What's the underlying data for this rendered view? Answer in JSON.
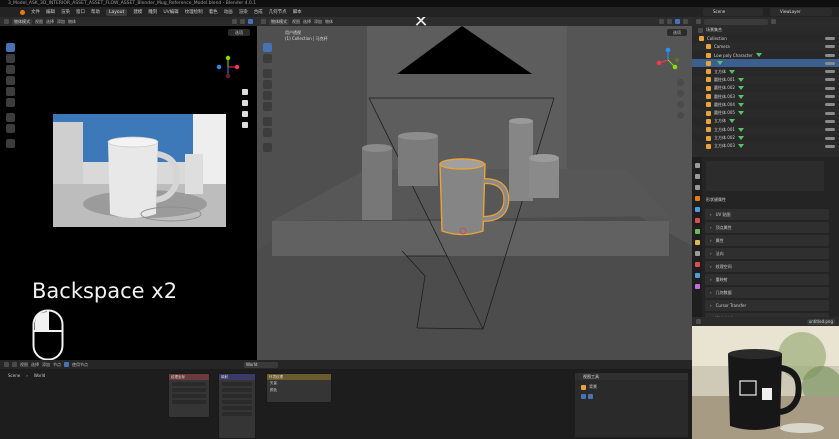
{
  "titlebar": {
    "text": "3_Model_ASK_3D_INTERIOR_ASSET_ASSET_FLOW_ASSET_Blender_Mug_Reference_Model.blend - Blender 4.0.1"
  },
  "menubar": {
    "items": [
      "文件",
      "编辑",
      "渲染",
      "窗口",
      "帮助"
    ],
    "workspaces": [
      "Layout",
      "建模",
      "雕刻",
      "UV编辑",
      "纹理绘制",
      "着色",
      "动画",
      "渲染",
      "合成",
      "几何节点",
      "脚本"
    ],
    "active_workspace": "Layout"
  },
  "left_view": {
    "header_mode": "物体模式",
    "header_items": [
      "视图",
      "选择",
      "添加",
      "物体"
    ],
    "options_label": "选项"
  },
  "main_view": {
    "header_mode": "物体模式",
    "header_items": [
      "视图",
      "选择",
      "添加",
      "物体"
    ],
    "hud_lines": [
      "用户透视",
      "(1) Collection | 马克杯"
    ],
    "options_label": "选项"
  },
  "overlay": {
    "key_text": "Backspace x2",
    "close_symbol": "✕"
  },
  "top_right": {
    "scene_label": "Scene",
    "view_layer_label": "ViewLayer"
  },
  "outliner": {
    "title": "场景集合",
    "items": [
      {
        "label": "Collection",
        "indent": 1
      },
      {
        "label": "Camera",
        "indent": 2
      },
      {
        "label": "Low poly Character",
        "indent": 2
      },
      {
        "label": "",
        "indent": 2,
        "selected": true
      },
      {
        "label": "立方体",
        "indent": 2
      },
      {
        "label": "圆柱体.001",
        "indent": 2
      },
      {
        "label": "圆柱体.002",
        "indent": 2
      },
      {
        "label": "圆柱体.003",
        "indent": 2
      },
      {
        "label": "圆柱体.004",
        "indent": 2
      },
      {
        "label": "圆柱体.005",
        "indent": 2
      },
      {
        "label": "立方体",
        "indent": 2
      },
      {
        "label": "立方体.001",
        "indent": 2
      },
      {
        "label": "立方体.002",
        "indent": 2
      },
      {
        "label": "立方体.003",
        "indent": 2
      }
    ]
  },
  "properties": {
    "section_title": "形状键属性",
    "panels": [
      "UV 贴图",
      "顶点属性",
      "属性",
      "法向",
      "纹理空间",
      "重映射",
      "几何数据",
      "Cursor Transfer",
      "Weight Layers",
      "自定义属性"
    ]
  },
  "preview": {
    "header_label": "untitled.png"
  },
  "node_editor": {
    "scene_label": "Scene",
    "world_label": "World",
    "header_items": [
      "视图",
      "选择",
      "添加",
      "节点"
    ],
    "use_nodes_label": "使用节点",
    "material_label": "World",
    "node_a_title": "纹理坐标",
    "node_b_title": "映射",
    "node_c_title": "环境纹理",
    "node_c_rows": [
      "矢量",
      "颜色"
    ],
    "side_title": "视图工具",
    "side_item": "背景"
  },
  "colors": {
    "select_orange": "#e8a33a",
    "selection_blue": "#4772b3",
    "gizmo_red": "#ff3352",
    "gizmo_green": "#8bdc00",
    "gizmo_blue": "#2890ff"
  }
}
